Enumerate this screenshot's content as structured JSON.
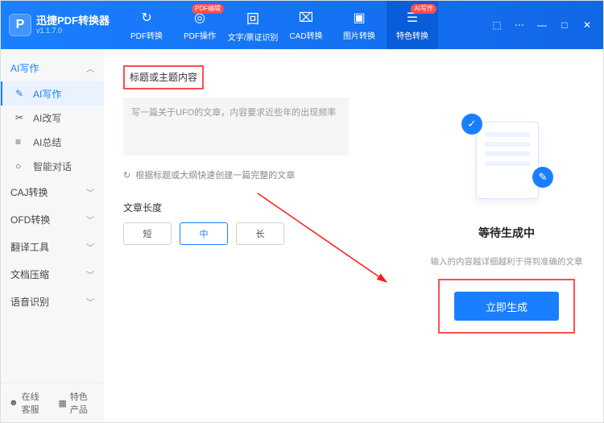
{
  "app": {
    "title": "迅捷PDF转换器",
    "version": "v1.1.7.0"
  },
  "topnav": {
    "items": [
      {
        "label": "PDF转换",
        "icon": "↻"
      },
      {
        "label": "PDF操作",
        "icon": "◎",
        "badge": "PDF编辑"
      },
      {
        "label": "文字/票证识别",
        "icon": "回"
      },
      {
        "label": "CAD转换",
        "icon": "⌧"
      },
      {
        "label": "图片转换",
        "icon": "▣"
      },
      {
        "label": "特色转换",
        "icon": "☰",
        "badge": "AI写作"
      }
    ]
  },
  "window": {
    "min": "—",
    "max": "□",
    "close": "✕"
  },
  "sidebar": {
    "groups": [
      {
        "label": "AI写作",
        "expanded": true,
        "subs": [
          {
            "label": "AI写作",
            "icon": "✎",
            "active": true
          },
          {
            "label": "AI改写",
            "icon": "✂"
          },
          {
            "label": "AI总结",
            "icon": "≡"
          },
          {
            "label": "智能对话",
            "icon": "○"
          }
        ]
      },
      {
        "label": "CAJ转换"
      },
      {
        "label": "OFD转换"
      },
      {
        "label": "翻译工具"
      },
      {
        "label": "文档压缩"
      },
      {
        "label": "语音识别"
      }
    ],
    "bottom": {
      "service": "在线客服",
      "featured": "特色产品"
    },
    "chev": {
      "down": "﹀",
      "up": "︿"
    }
  },
  "editor": {
    "title_label": "标题或主题内容",
    "title_placeholder": "写一篇关于UFO的文章，内容要求近些年的出现频率",
    "hint": "根据标题或大纲快速创建一篇完整的文章",
    "hint_icon": "↻",
    "length_label": "文章长度",
    "length_opts": [
      "短",
      "中",
      "长"
    ],
    "length_selected": 1
  },
  "preview": {
    "wait_title": "等待生成中",
    "wait_sub": "输入的内容越详细越利于得到准确的文章",
    "generate": "立即生成",
    "badge1": "✓",
    "badge2": "✎"
  }
}
